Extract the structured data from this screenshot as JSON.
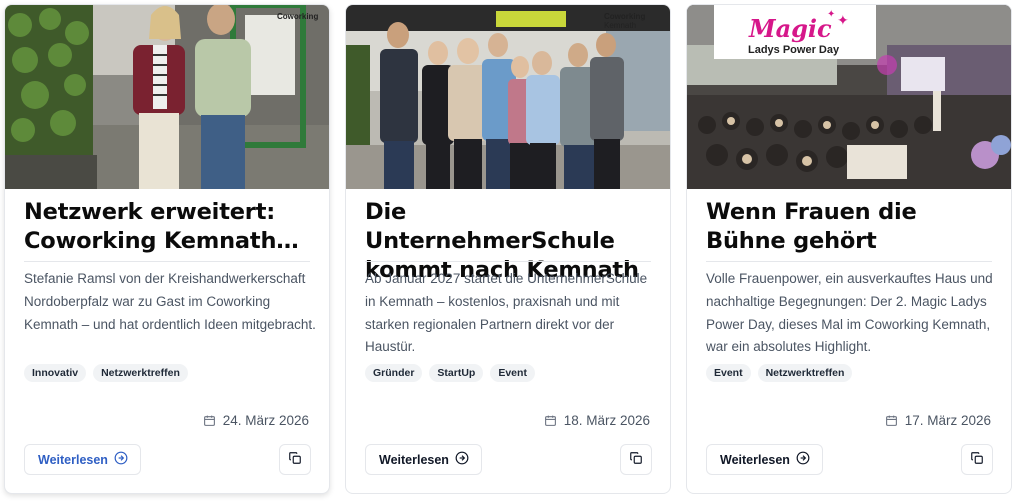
{
  "cards": [
    {
      "title": "Netzwerk erweitert: Coworking Kemnath…",
      "excerpt": "Stefanie Ramsl von der Kreishandwerkerschaft Nordoberpfalz war zu Gast im Coworking Kemnath – und hat ordentlich Ideen mitgebracht.",
      "tags": [
        "Innovativ",
        "Netzwerktreffen"
      ],
      "date": "24. März 2026",
      "read_more_label": "Weiterlesen",
      "image_sign": "Coworking"
    },
    {
      "title": "Die UnternehmerSchule kommt nach Kemnath",
      "excerpt": "Ab Januar 2027 startet die UnternehmerSchule in Kemnath – kostenlos, praxisnah und mit starken regionalen Partnern direkt vor der Haustür.",
      "tags": [
        "Gründer",
        "StartUp",
        "Event"
      ],
      "date": "18. März 2026",
      "read_more_label": "Weiterlesen",
      "image_sign": "Coworking\nKemnath"
    },
    {
      "title": "Wenn Frauen die Bühne gehört",
      "excerpt": "Volle Frauenpower, ein ausverkauftes Haus und nachhaltige Begegnungen: Der 2. Magic Ladys Power Day, dieses Mal im Coworking Kemnath, war ein absolutes Highlight.",
      "tags": [
        "Event",
        "Netzwerktreffen"
      ],
      "date": "17. März 2026",
      "read_more_label": "Weiterlesen",
      "image_logo_top": "Magic",
      "image_logo_bottom": "Ladys Power Day"
    }
  ],
  "colors": {
    "accent_link": "#2f5fc4",
    "tag_bg": "#f1f3f5",
    "border": "#e5e7eb",
    "magic_pink": "#d6178a"
  },
  "icons": {
    "date": "calendar-icon",
    "read_more": "arrow-right-circle-icon",
    "copy": "copy-icon"
  }
}
